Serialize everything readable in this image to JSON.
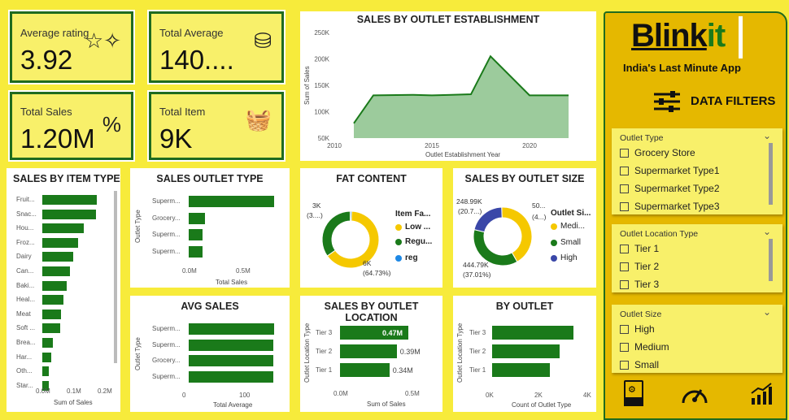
{
  "colors": {
    "background": "#f7eb3b",
    "kpi_fill": "#f8f06a",
    "kpi_border": "#1f6b1f",
    "bar_green": "#1a7a1a",
    "area_green": "#9ccb9c",
    "yellow": "#f5c800",
    "blue": "#3a47a8",
    "light_blue": "#1e88e5",
    "sidebar": "#e5b800"
  },
  "kpis": [
    {
      "label": "Average rating",
      "value": "3.92",
      "icon": "stars-icon"
    },
    {
      "label": "Total Average",
      "value": "140....",
      "icon": "coins-growth-icon"
    },
    {
      "label": "Total Sales",
      "value": "1.20M",
      "icon": "sale-tag-icon"
    },
    {
      "label": "Total Item",
      "value": "9K",
      "icon": "shopping-basket-icon"
    }
  ],
  "brand": {
    "name_part1": "Blink",
    "name_part2": "it",
    "tagline": "India's Last Minute App",
    "filters_title": "DATA FILTERS"
  },
  "slicers": {
    "outlet_type": {
      "title": "Outlet Type",
      "options": [
        "Grocery Store",
        "Supermarket Type1",
        "Supermarket Type2",
        "Supermarket Type3"
      ]
    },
    "outlet_location_type": {
      "title": "Outlet Location Type",
      "options": [
        "Tier 1",
        "Tier 2",
        "Tier 3"
      ]
    },
    "outlet_size": {
      "title": "Outlet Size",
      "options": [
        "High",
        "Medium",
        "Small"
      ]
    }
  },
  "bottom_icons": [
    "dat-file-icon",
    "gauge-icon",
    "bar-growth-icon"
  ],
  "chart_data": [
    {
      "id": "sales_by_item_type",
      "type": "bar",
      "title": "SALES BY ITEM TYPE",
      "categories": [
        "Fruit...",
        "Snac...",
        "Hou...",
        "Froz...",
        "Dairy",
        "Can...",
        "Baki...",
        "Heal...",
        "Meat",
        "Soft ...",
        "Brea...",
        "Har...",
        "Oth...",
        "Star..."
      ],
      "values": [
        0.178,
        0.175,
        0.136,
        0.118,
        0.1,
        0.09,
        0.08,
        0.068,
        0.06,
        0.058,
        0.035,
        0.029,
        0.021,
        0.02
      ],
      "xlabel": "Sum of Sales",
      "ticks": [
        "0.0M",
        "0.1M",
        "0.2M"
      ],
      "xlim": [
        0,
        0.2
      ]
    },
    {
      "id": "sales_outlet_type",
      "type": "bar",
      "title": "SALES OUTLET TYPE",
      "categories": [
        "Superm...",
        "Grocery...",
        "Superm...",
        "Superm..."
      ],
      "values": [
        0.79,
        0.15,
        0.13,
        0.13
      ],
      "xlabel": "Total Sales",
      "ylabel": "Outlet Type",
      "ticks": [
        "0.0M",
        "0.5M"
      ],
      "xlim": [
        0,
        0.8
      ]
    },
    {
      "id": "avg_sales",
      "type": "bar",
      "title": "AVG SALES",
      "categories": [
        "Superm...",
        "Superm...",
        "Grocery...",
        "Superm..."
      ],
      "values": [
        141,
        140,
        140,
        139
      ],
      "xlabel": "Total Average",
      "ylabel": "Outlet Type",
      "ticks": [
        "0",
        "100"
      ],
      "xlim": [
        0,
        150
      ]
    },
    {
      "id": "sales_by_outlet_establishment",
      "type": "area",
      "title": "SALES BY OUTLET ESTABLISHMENT",
      "x": [
        2011,
        2012,
        2014,
        2015,
        2016,
        2017,
        2018,
        2020,
        2022
      ],
      "values": [
        78,
        131,
        132,
        131,
        132,
        133,
        205,
        131,
        131
      ],
      "xlabel": "Outlet Establishment Year",
      "ylabel": "Sum of Sales",
      "yticks": [
        "250K",
        "200K",
        "150K",
        "100K",
        "50K"
      ],
      "xticks": [
        "2010",
        "2015",
        "2020"
      ],
      "xlim": [
        2010,
        2023
      ],
      "ylim": [
        50,
        250
      ]
    },
    {
      "id": "fat_content",
      "type": "pie",
      "title": "FAT CONTENT",
      "legend_title": "Item Fa...",
      "labels": [
        "Low ...",
        "Regu...",
        "reg"
      ],
      "values": [
        64.73,
        34.5,
        0.77
      ],
      "data_labels": {
        "low": "6K",
        "low_pct": "(64.73%)",
        "reg": "3K",
        "reg_pct": "(3....)"
      }
    },
    {
      "id": "sales_by_outlet_size",
      "type": "pie",
      "title": "SALES BY OUTLET SIZE",
      "legend_title": "Outlet Si...",
      "labels": [
        "Medi...",
        "Small",
        "High"
      ],
      "values": [
        42.3,
        37.01,
        20.7
      ],
      "data_labels": {
        "medium": "50...",
        "medium_pct": "(4...)",
        "small": "444.79K",
        "small_pct": "(37.01%)",
        "high": "248.99K",
        "high_pct": "(20.7...)"
      }
    },
    {
      "id": "sales_by_outlet_location",
      "type": "bar",
      "title": "SALES BY OUTLET LOCATION",
      "categories": [
        "Tier 3",
        "Tier 2",
        "Tier 1"
      ],
      "values": [
        0.47,
        0.39,
        0.34
      ],
      "value_labels": [
        "0.47M",
        "0.39M",
        "0.34M"
      ],
      "xlabel": "Sum of Sales",
      "ylabel": "Outlet Location Type",
      "ticks": [
        "0.0M",
        "0.5M"
      ],
      "xlim": [
        0,
        0.5
      ]
    },
    {
      "id": "by_outlet",
      "type": "bar",
      "title": "BY OUTLET",
      "categories": [
        "Tier 3",
        "Tier 2",
        "Tier 1"
      ],
      "values": [
        3350,
        2785,
        2390
      ],
      "xlabel": "Count of Outlet Type",
      "ylabel": "Outlet Location Type",
      "ticks": [
        "0K",
        "2K",
        "4K"
      ],
      "xlim": [
        0,
        4000
      ]
    }
  ]
}
